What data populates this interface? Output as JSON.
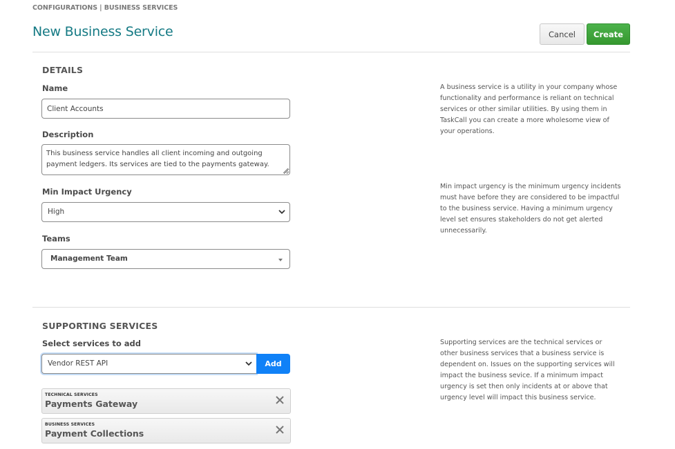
{
  "breadcrumb": "CONFIGURATIONS | BUSINESS SERVICES",
  "page_title": "New Business Service",
  "actions": {
    "cancel_label": "Cancel",
    "create_label": "Create"
  },
  "details": {
    "section_title": "DETAILS",
    "name_label": "Name",
    "name_value": "Client Accounts",
    "description_label": "Description",
    "description_value": "This business service handles all client incoming and outgoing payment ledgers. Its services are tied to the payments gateway.",
    "urgency_label": "Min Impact Urgency",
    "urgency_value": "High",
    "teams_label": "Teams",
    "teams_value": "Management Team",
    "help_business_service": "A business service is a utility in your company whose functionality and performance is reliant on technical services or other similar utilities. By using them in TaskCall you can create a more wholesome view of your operations.",
    "help_urgency": "Min impact urgency is the minimum urgency incidents must have before they are considered to be impactful to the business service. Having a minimum urgency level set ensures stakeholders do not get alerted unnecessarily."
  },
  "supporting": {
    "section_title": "SUPPORTING SERVICES",
    "select_label": "Select services to add",
    "select_value": "Vendor REST API",
    "add_label": "Add",
    "help": "Supporting services are the technical services or other business services that a business service is dependent on. Issues on the supporting services will impact the business sevice. If a minimum impact urgency is set then only incidents at or above that urgency level will impact this business service.",
    "items": [
      {
        "type": "TECHNICAL SERVICES",
        "name": "Payments Gateway"
      },
      {
        "type": "BUSINESS SERVICES",
        "name": "Payment Collections"
      }
    ]
  }
}
